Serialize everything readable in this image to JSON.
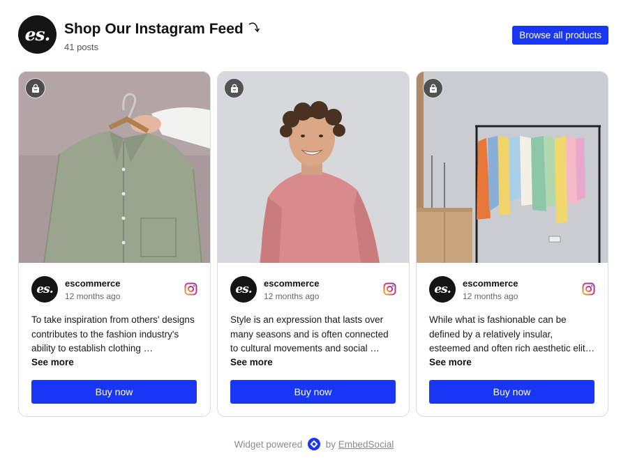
{
  "header": {
    "logo_text": "es.",
    "title": "Shop Our Instagram Feed",
    "posts_count": "41 posts",
    "browse_button": "Browse all products"
  },
  "posts": [
    {
      "author": "escommerce",
      "avatar_text": "es.",
      "time": "12 months ago",
      "caption": "To take inspiration from others' designs contributes to the fashion industry's ability to establish clothing …",
      "see_more": "See more",
      "buy_button": "Buy now",
      "image": "green-shirt-on-hanger"
    },
    {
      "author": "escommerce",
      "avatar_text": "es.",
      "time": "12 months ago",
      "caption": "Style is an expression that lasts over many seasons and is often connected to cultural movements and social …",
      "see_more": "See more",
      "buy_button": "Buy now",
      "image": "smiling-person-pink-tshirt"
    },
    {
      "author": "escommerce",
      "avatar_text": "es.",
      "time": "12 months ago",
      "caption": "While what is fashionable can be defined by a relatively insular, esteemed and often rich aesthetic elit…",
      "see_more": "See more",
      "buy_button": "Buy now",
      "image": "clothing-rack"
    }
  ],
  "footer": {
    "prefix": "Widget powered",
    "by": "by",
    "link": "EmbedSocial"
  },
  "icons": {
    "badge": "shopping-bag-icon",
    "platform": "instagram-icon",
    "title_decoration": "curved-arrow-icon"
  },
  "colors": {
    "accent": "#1a36f5",
    "text": "#111111",
    "muted": "#666666"
  }
}
